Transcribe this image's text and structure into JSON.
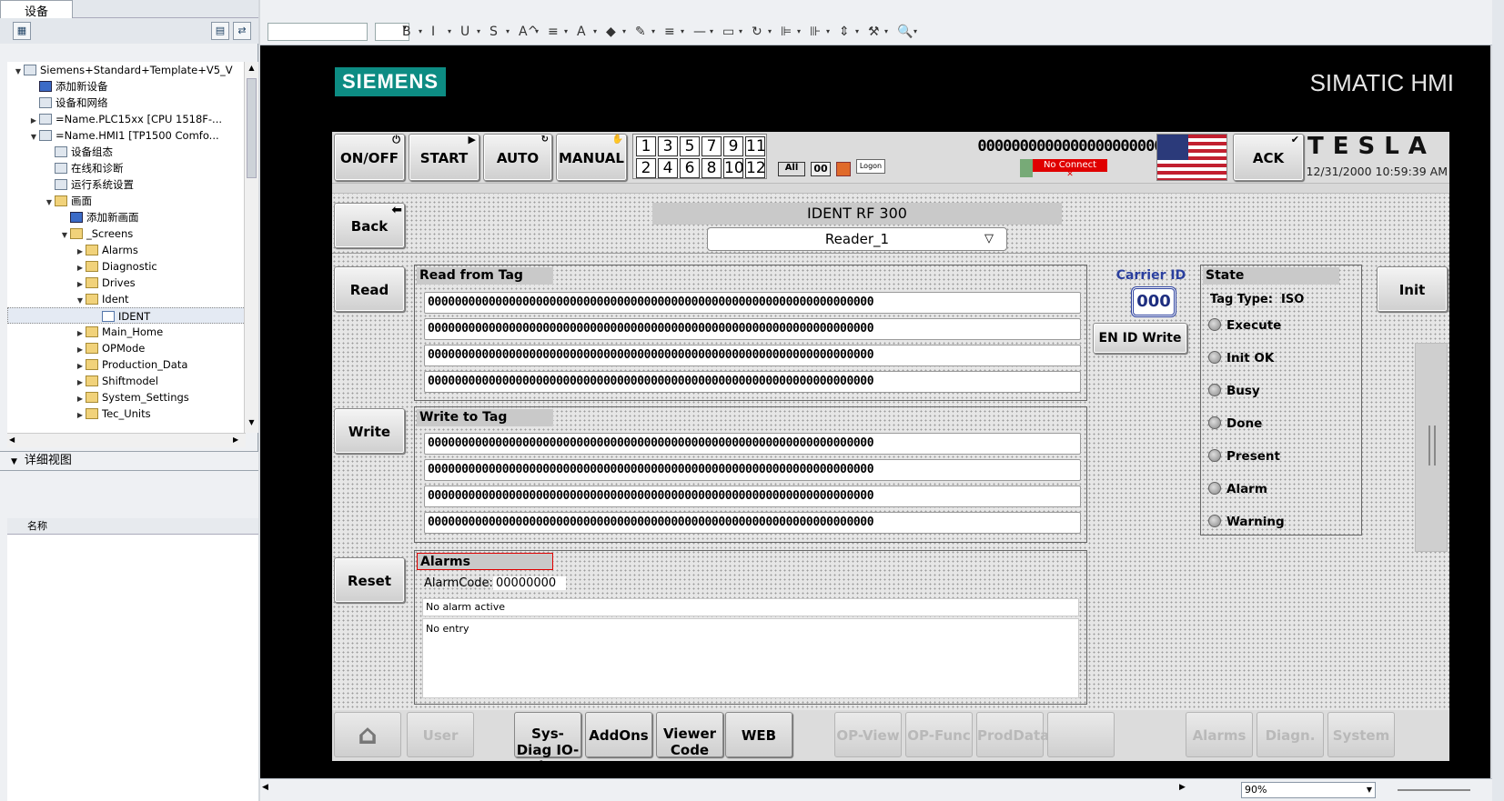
{
  "left_panel": {
    "tab_label": "设备",
    "tree": [
      {
        "label": "Siemens+Standard+Template+V5_V",
        "level": 0,
        "expanded": true,
        "icon": "project-icon"
      },
      {
        "label": "添加新设备",
        "level": 1,
        "icon": "add-device-icon"
      },
      {
        "label": "设备和网络",
        "level": 1,
        "icon": "network-icon"
      },
      {
        "label": "=Name.PLC15xx [CPU 1518F-...",
        "level": 1,
        "expandable": true,
        "icon": "plc-icon"
      },
      {
        "label": "=Name.HMI1 [TP1500 Comfo...",
        "level": 1,
        "expanded": true,
        "icon": "hmi-icon"
      },
      {
        "label": "设备组态",
        "level": 2,
        "icon": "config-icon"
      },
      {
        "label": "在线和诊断",
        "level": 2,
        "icon": "diagnostics-icon"
      },
      {
        "label": "运行系统设置",
        "level": 2,
        "icon": "runtime-settings-icon"
      },
      {
        "label": "画面",
        "level": 2,
        "expanded": true,
        "icon": "folder-icon"
      },
      {
        "label": "添加新画面",
        "level": 3,
        "icon": "add-screen-icon"
      },
      {
        "label": "_Screens",
        "level": 3,
        "expanded": true,
        "icon": "folder-icon"
      },
      {
        "label": "Alarms",
        "level": 4,
        "expandable": true,
        "icon": "folder-icon"
      },
      {
        "label": "Diagnostic",
        "level": 4,
        "expandable": true,
        "icon": "folder-icon"
      },
      {
        "label": "Drives",
        "level": 4,
        "expandable": true,
        "icon": "folder-icon"
      },
      {
        "label": "Ident",
        "level": 4,
        "expanded": true,
        "icon": "folder-icon"
      },
      {
        "label": "IDENT",
        "level": 5,
        "selected": true,
        "icon": "screen-icon"
      },
      {
        "label": "Main_Home",
        "level": 4,
        "expandable": true,
        "icon": "folder-icon"
      },
      {
        "label": "OPMode",
        "level": 4,
        "expandable": true,
        "icon": "folder-icon"
      },
      {
        "label": "Production_Data",
        "level": 4,
        "expandable": true,
        "icon": "folder-icon"
      },
      {
        "label": "Shiftmodel",
        "level": 4,
        "expandable": true,
        "icon": "folder-icon"
      },
      {
        "label": "System_Settings",
        "level": 4,
        "expandable": true,
        "icon": "folder-icon"
      },
      {
        "label": "Tec_Units",
        "level": 4,
        "expandable": true,
        "icon": "folder-icon"
      }
    ],
    "detail_title": "详细视图",
    "detail_column": "名称"
  },
  "toolbar": {
    "icons": [
      "bold-icon",
      "italic-icon",
      "underline-icon",
      "strikethrough-icon",
      "font-size-icon",
      "align-icon",
      "font-color-icon",
      "fill-color-icon",
      "line-color-icon",
      "line-style-icon",
      "line-width-icon",
      "arrange-icon",
      "rotate-icon",
      "align-objects-icon",
      "distribute-icon",
      "same-size-icon",
      "format-painter-icon",
      "zoom-icon"
    ],
    "glyphs": [
      "B",
      "I",
      "U",
      "S",
      "A^",
      "≡",
      "A",
      "◆",
      "✎",
      "≡",
      "—",
      "▭",
      "↻",
      "⊫",
      "⊪",
      "⇕",
      "⚒",
      "🔍"
    ],
    "font_value": "",
    "size_value": ""
  },
  "hmi": {
    "brand": "SIEMENS",
    "product": "SIMATIC HMI",
    "header_buttons": [
      "ON/OFF",
      "START",
      "AUTO",
      "MANUAL"
    ],
    "number_grid_row1": [
      "1",
      "3",
      "5",
      "7",
      "9",
      "11"
    ],
    "number_grid_row2": [
      "2",
      "4",
      "6",
      "8",
      "10",
      "12"
    ],
    "counter": "0000000000000000000000000000",
    "small_labels": {
      "all": "All",
      "zero": "00",
      "logon": "Logon"
    },
    "connection_status": "No Connect",
    "ack_label": "ACK",
    "tesla_logo": "TESLA",
    "datetime": "12/31/2000 10:59:39 AM",
    "title": "IDENT RF 300",
    "reader": "Reader_1",
    "side_buttons": {
      "back": "Back",
      "read": "Read",
      "write": "Write",
      "reset": "Reset",
      "init": "Init",
      "en_id_write": "EN ID Write"
    },
    "read_panel": {
      "title": "Read from Tag",
      "rows": [
        "000000000000000000000000000000000000000000000000000000000000000000",
        "000000000000000000000000000000000000000000000000000000000000000000",
        "000000000000000000000000000000000000000000000000000000000000000000",
        "000000000000000000000000000000000000000000000000000000000000000000"
      ]
    },
    "write_panel": {
      "title": "Write to Tag",
      "rows": [
        "000000000000000000000000000000000000000000000000000000000000000000",
        "000000000000000000000000000000000000000000000000000000000000000000",
        "000000000000000000000000000000000000000000000000000000000000000000",
        "000000000000000000000000000000000000000000000000000000000000000000"
      ]
    },
    "carrier": {
      "label": "Carrier ID",
      "value": "000"
    },
    "state": {
      "title": "State",
      "tag_type_label": "Tag Type:",
      "tag_type_value": "ISO",
      "items": [
        "Execute",
        "Init OK",
        "Busy",
        "Done",
        "Present",
        "Alarm",
        "Warning"
      ]
    },
    "alarms": {
      "title": "Alarms",
      "code_label": "AlarmCode:",
      "code_value": "00000000",
      "status": "No alarm active",
      "entry": "No entry"
    },
    "nav_buttons": [
      {
        "label": "",
        "active": false,
        "icon": "home-icon"
      },
      {
        "label": "User",
        "active": false
      },
      {
        "label": "Sys-Diag IO-view",
        "active": true
      },
      {
        "label": "AddOns",
        "active": true
      },
      {
        "label": "Viewer Code",
        "active": true
      },
      {
        "label": "WEB",
        "active": true
      },
      {
        "label": "OP-View",
        "active": false
      },
      {
        "label": "OP-Func",
        "active": false
      },
      {
        "label": "ProdData",
        "active": false
      },
      {
        "label": "",
        "active": false
      },
      {
        "label": "Alarms",
        "active": false
      },
      {
        "label": "Diagn.",
        "active": false
      },
      {
        "label": "System",
        "active": false
      }
    ]
  },
  "zoom": {
    "value": "90%"
  },
  "colors": {
    "siemens_teal": "#0d8c83",
    "carrier_blue": "#2a3f9e",
    "alarm_red": "#e00000"
  }
}
